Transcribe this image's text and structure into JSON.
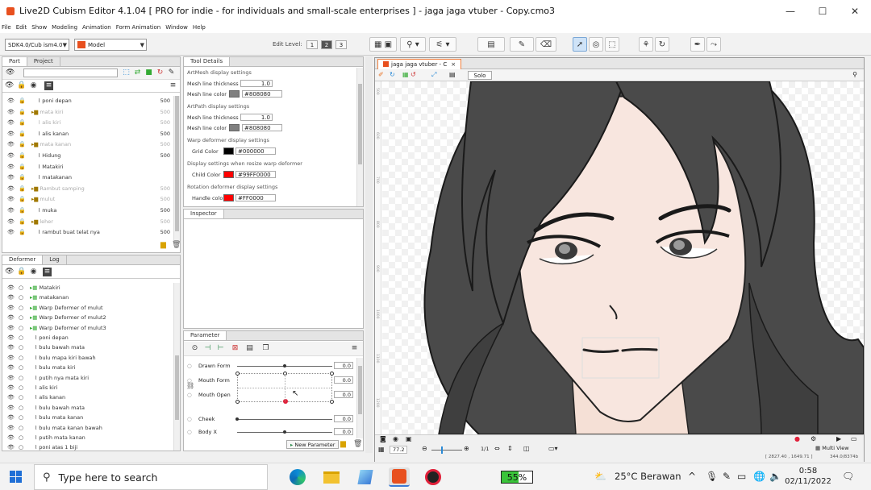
{
  "window": {
    "title": "Live2D Cubism Editor 4.1.04   [ PRO for indie - for individuals and small-scale enterprises ] - jaga jaga vtuber - Copy.cmo3"
  },
  "menu": [
    "File",
    "Edit",
    "Show",
    "Modeling",
    "Animation",
    "Form Animation",
    "Window",
    "Help"
  ],
  "toolbar": {
    "version_select": "SDK4.0/Cub ism4.0",
    "mode_select": "Model",
    "edit_level_label": "Edit Level:",
    "edit_levels": [
      "1",
      "2",
      "3"
    ],
    "active_edit_level": "2"
  },
  "part_panel": {
    "tabs": [
      "Part",
      "Project"
    ],
    "active_tab": "Part",
    "rows": [
      {
        "label": "poni depan",
        "value": "500",
        "dim": false,
        "folder": false
      },
      {
        "label": "mata kiri",
        "value": "500",
        "dim": true,
        "folder": true
      },
      {
        "label": "alis kiri",
        "value": "500",
        "dim": true,
        "folder": false
      },
      {
        "label": "alis kanan",
        "value": "500",
        "dim": false,
        "folder": false
      },
      {
        "label": "mata kanan",
        "value": "500",
        "dim": true,
        "folder": true
      },
      {
        "label": "Hidung",
        "value": "500",
        "dim": false,
        "folder": false
      },
      {
        "label": "Matakiri",
        "value": "",
        "dim": false,
        "folder": false
      },
      {
        "label": "matakanan",
        "value": "",
        "dim": false,
        "folder": false
      },
      {
        "label": "Rambut samping",
        "value": "500",
        "dim": true,
        "folder": true
      },
      {
        "label": "mulut",
        "value": "500",
        "dim": true,
        "folder": true
      },
      {
        "label": "muka",
        "value": "500",
        "dim": false,
        "folder": false
      },
      {
        "label": "leher",
        "value": "500",
        "dim": true,
        "folder": true
      },
      {
        "label": "rambut buat telat nya",
        "value": "500",
        "dim": false,
        "folder": false
      }
    ]
  },
  "tool_details": {
    "tab": "Tool Details",
    "sections": [
      {
        "heading": "ArtMesh display settings",
        "items": [
          {
            "label": "Mesh line thickness",
            "kind": "number",
            "value": "1.0"
          },
          {
            "label": "Mesh line color",
            "kind": "color",
            "color": "#808080",
            "value": "#808080"
          }
        ]
      },
      {
        "heading": "ArtPath display settings",
        "items": [
          {
            "label": "Mesh line thickness",
            "kind": "number",
            "value": "1.0"
          },
          {
            "label": "Mesh line color",
            "kind": "color",
            "color": "#808080",
            "value": "#808080"
          }
        ]
      },
      {
        "heading": "Warp deformer display settings",
        "items": [
          {
            "label": "Grid Color",
            "kind": "color",
            "color": "#000000",
            "value": "#000000"
          }
        ]
      },
      {
        "heading": "Display settings when resize warp deformer",
        "items": [
          {
            "label": "Child Color",
            "kind": "color",
            "color": "#99FF0000",
            "value": "#99FF0000"
          }
        ]
      },
      {
        "heading": "Rotation deformer display settings",
        "items": [
          {
            "label": "Handle color",
            "kind": "color",
            "color": "#FF0000",
            "value": "#FF0000"
          }
        ]
      }
    ]
  },
  "inspector": {
    "tab": "Inspector"
  },
  "deformer_panel": {
    "tabs": [
      "Deformer",
      "Log"
    ],
    "active_tab": "Deformer",
    "rows": [
      {
        "label": "Matakiri",
        "folder": true
      },
      {
        "label": "matakanan",
        "folder": true
      },
      {
        "label": "Warp Deformer of mulut",
        "folder": true
      },
      {
        "label": "Warp Deformer of mulut2",
        "folder": true
      },
      {
        "label": "Warp Deformer of mulut3",
        "folder": true
      },
      {
        "label": "poni depan",
        "folder": false
      },
      {
        "label": "bulu bawah mata",
        "folder": false
      },
      {
        "label": "bulu mapa kiri bawah",
        "folder": false
      },
      {
        "label": "bulu mata kiri",
        "folder": false
      },
      {
        "label": "putih nya mata kiri",
        "folder": false
      },
      {
        "label": "alis kiri",
        "folder": false
      },
      {
        "label": "alis kanan",
        "folder": false
      },
      {
        "label": "bulu bawah mata",
        "folder": false
      },
      {
        "label": "bulu mata kanan",
        "folder": false
      },
      {
        "label": "bulu mata kanan bawah",
        "folder": false
      },
      {
        "label": "putih mata kanan",
        "folder": false
      },
      {
        "label": "poni atas 1 biji",
        "folder": false
      }
    ]
  },
  "parameter_panel": {
    "tab": "Parameter",
    "params": [
      {
        "label": "Drawn Form",
        "value": "0.0",
        "position": 0.5
      },
      {
        "label": "Mouth Form",
        "value": "0.0",
        "position": 0.5
      },
      {
        "label": "Mouth Open",
        "value": "0.0",
        "position": 0.5
      },
      {
        "label": "Cheek",
        "value": "0.0",
        "position": 0.0
      },
      {
        "label": "Body X",
        "value": "0.0",
        "position": 0.5
      }
    ],
    "new_button": "New Parameter"
  },
  "canvas": {
    "doc_tab": "jaga jaga vtuber - C",
    "solo_label": "Solo",
    "ruler_ticks": [
      "500",
      "600",
      "700",
      "800",
      "900",
      "1000",
      "1100",
      "1200"
    ],
    "zoom": "77.2",
    "zoom_ratio": "1/1",
    "view_mode": "Multi View",
    "coords": "[ 2827.40 , 1649.71 ]",
    "coords_right": "344.0/8374b"
  },
  "taskbar": {
    "search_placeholder": "Type here to search",
    "battery": "55%",
    "battery_level": 0.55,
    "weather": "25°C  Berawan",
    "time": "0:58",
    "date": "02/11/2022"
  },
  "colors": {
    "accent": "#e8501f",
    "hair": "#4a4a4a",
    "skin": "#f7e4dc",
    "lines": "#222222"
  }
}
